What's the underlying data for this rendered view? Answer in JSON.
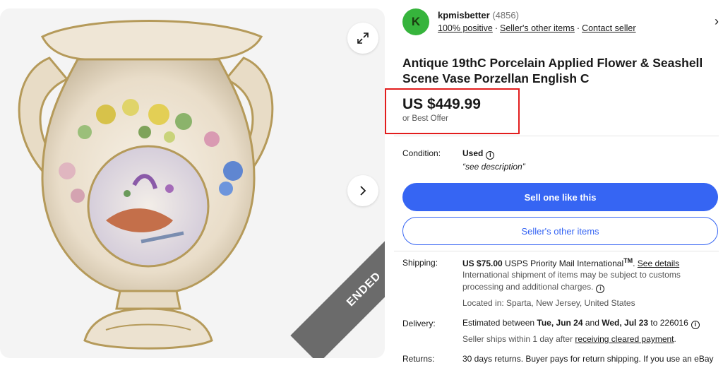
{
  "gallery": {
    "status_ribbon": "ENDED",
    "expand_icon": "expand-icon",
    "next_icon": "chevron-right-icon"
  },
  "seller": {
    "initial": "K",
    "name": "kpmisbetter",
    "feedback_count": "(4856)",
    "positive": "100% positive",
    "other_items": "Seller's other items",
    "contact": "Contact seller",
    "chevron": "›"
  },
  "listing": {
    "title": "Antique 19thC Porcelain Applied Flower & Seashell Scene Vase Porzellan English C",
    "price": "US $449.99",
    "best_offer": "or Best Offer"
  },
  "condition": {
    "label": "Condition:",
    "value": "Used",
    "quote": "“see description”"
  },
  "buttons": {
    "sell_one": "Sell one like this",
    "sellers_items": "Seller's other items"
  },
  "shipping": {
    "label": "Shipping:",
    "price": "US $75.00",
    "service": " USPS Priority Mail International",
    "tm": "TM",
    "details_link": "See details",
    "note_line1": "International shipment of items may be subject to customs",
    "note_line2": "processing and additional charges.",
    "located": "Located in: Sparta, New Jersey, United States"
  },
  "delivery": {
    "label": "Delivery:",
    "prefix": "Estimated between ",
    "date1": "Tue, Jun 24",
    "and": " and ",
    "date2": "Wed, Jul 23",
    "suffix": " to 226016",
    "ships_prefix": "Seller ships within 1 day after ",
    "ships_link": "receiving cleared payment",
    "ships_suffix": "."
  },
  "returns": {
    "label": "Returns:",
    "text": "30 days returns. Buyer pays for return shipping. If you use an eBay"
  },
  "colors": {
    "accent": "#3665f3",
    "avatar_bg": "#36b43c",
    "highlight_box": "#e21d1d",
    "ribbon": "#6b6b6b"
  }
}
